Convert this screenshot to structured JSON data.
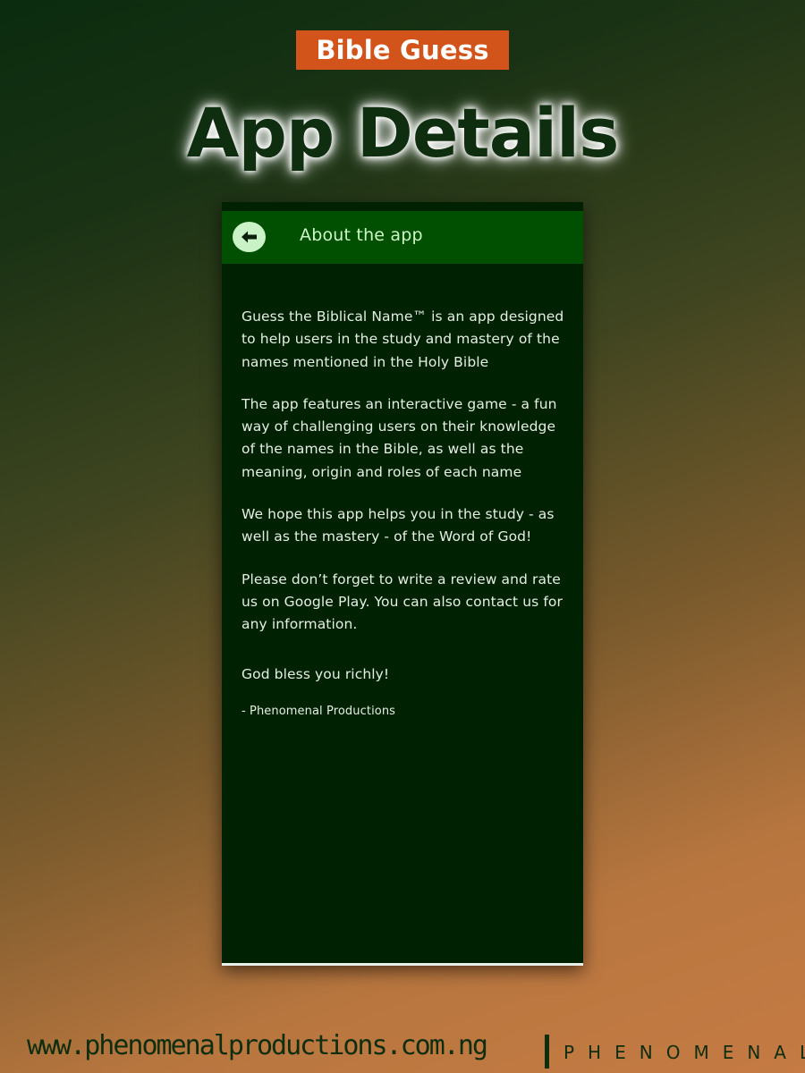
{
  "header": {
    "badge_text": "Bible Guess",
    "headline": "App Details"
  },
  "app_screen": {
    "appbar": {
      "back_icon": "arrow-left-icon",
      "title": "About the app"
    },
    "paragraphs": [
      "Guess the Biblical Name™ is an app designed to help users in the study and mastery of the names mentioned in the Holy Bible",
      "The app features an interactive game - a fun way of challenging users on their knowledge of the names in the Bible, as well as the meaning, origin and roles of each name",
      "We hope this app helps you in the study - as well as the mastery - of the Word of God!",
      "Please don’t forget to write a review and rate us on Google Play. You can also contact us for any information."
    ],
    "blessing": "God bless you richly!",
    "signature": "- Phenomenal Productions"
  },
  "footer": {
    "url": "www.phenomenalproductions.com.ng",
    "logo_text": "PHENOMENAL"
  },
  "colors": {
    "badge_bg": "#d2541a",
    "appbar_bg": "#014f00",
    "screen_bg": "#002203",
    "back_button_bg": "#c9f2c6",
    "title_color": "#cdf6c6",
    "headline_color": "#0f2d0f"
  }
}
